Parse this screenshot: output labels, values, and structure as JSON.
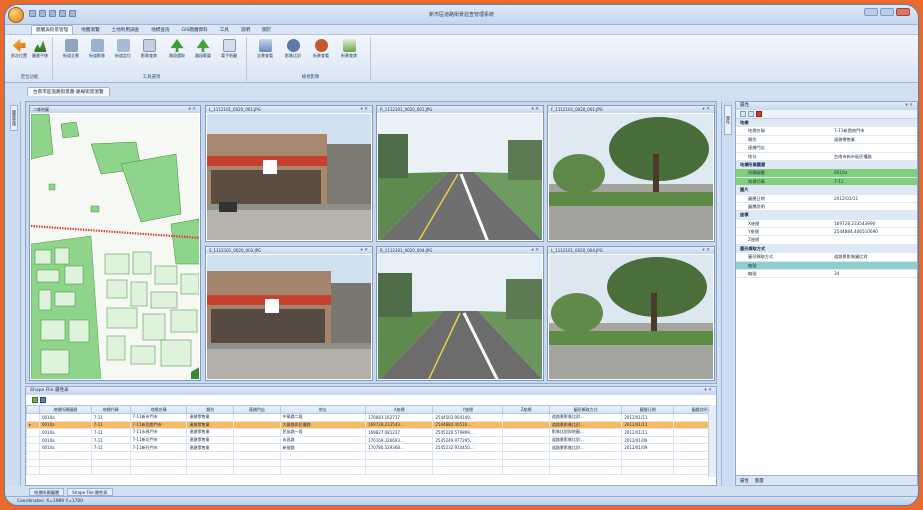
{
  "window": {
    "title": "新市區道路街景巡查管理系統"
  },
  "menu": {
    "tabs": [
      "圖層與街景管理",
      "地圖瀏覽",
      "土地利用調查",
      "地標查詢",
      "GIS圖層資料",
      "工具",
      "說明",
      "關於"
    ],
    "active_index": 0
  },
  "ribbon": {
    "groups": [
      {
        "label": "定位功能",
        "buttons": [
          "前次位置",
          "圖層平移"
        ]
      },
      {
        "label": "工具選項",
        "buttons": [
          "街道全景",
          "街道影像",
          "街道定位",
          "影像查詢",
          "路段選取",
          "路段範圍",
          "電子地圖"
        ]
      },
      {
        "label": "檢視影像",
        "buttons": [
          "全景查看",
          "影像比對",
          "街景查看",
          "街景查詢"
        ]
      }
    ]
  },
  "doc_tab": "台南市區道路街景圖-路線街景瀏覽",
  "left_strip_tab": "圖層管理",
  "right_strip_tab": "屬性",
  "map_pane": {
    "title": "二維地圖"
  },
  "photos": [
    {
      "title": "L_1112101_0020_001.JPG"
    },
    {
      "title": "R_1112101_0020_001.JPG"
    },
    {
      "title": "F_1112101_0020_001.JPG"
    },
    {
      "title": "S_1112101_0020_003.JPG"
    },
    {
      "title": "R_1112101_0020_004.JPG"
    },
    {
      "title": "L_1112101_0020_004.JPG"
    }
  ],
  "attributes": {
    "title": "屬性",
    "rows": [
      {
        "k": "地標",
        "v": "",
        "type": "cat"
      },
      {
        "k": "地標名稱",
        "v": "7-11新園南門市",
        "type": ""
      },
      {
        "k": "類別",
        "v": "連鎖零售業",
        "type": ""
      },
      {
        "k": "連鎖門店",
        "v": "",
        "type": ""
      },
      {
        "k": "地址",
        "v": "台南市新市區民權路",
        "type": ""
      },
      {
        "k": "地標所屬圖層",
        "v": "",
        "type": "cat"
      },
      {
        "k": "所屬圖層",
        "v": "0010a",
        "type": "green"
      },
      {
        "k": "地標代碼",
        "v": "7-11",
        "type": "green"
      },
      {
        "k": "圖片",
        "v": "",
        "type": "cat"
      },
      {
        "k": "圖層日期",
        "v": "2012/01/11",
        "type": ""
      },
      {
        "k": "圖層說明",
        "v": "",
        "type": ""
      },
      {
        "k": "座標",
        "v": "",
        "type": "cat"
      },
      {
        "k": "X座標",
        "v": "169728.233543990",
        "type": ""
      },
      {
        "k": "Y座標",
        "v": "2544884.406510690",
        "type": ""
      },
      {
        "k": "Z座標",
        "v": "",
        "type": ""
      },
      {
        "k": "圖形擷取方式",
        "v": "",
        "type": "cat"
      },
      {
        "k": "圖形擷取方式",
        "v": "道路景影像圖比對",
        "type": ""
      },
      {
        "k": "編號",
        "v": "",
        "type": "teal"
      },
      {
        "k": "編號",
        "v": "34",
        "type": ""
      }
    ],
    "footer": [
      "屬性",
      "圖層"
    ]
  },
  "grid": {
    "title": "Shape File 屬性表",
    "columns": [
      "地標所屬圖層",
      "地標代碼",
      "地標名稱",
      "類別",
      "連鎖門店",
      "地址",
      "X座標",
      "Y座標",
      "Z座標",
      "圖形擷取方式",
      "圖層日期",
      "圖層說明"
    ],
    "rows": [
      [
        "0010a",
        "7-11",
        "7-11新市門市",
        "連鎖零售業",
        "",
        "中華路二段",
        "170081.162717",
        "2544503.904149…",
        "",
        "道路景影像比對…",
        "2012/01/11",
        ""
      ],
      [
        "0010a",
        "7-11",
        "7-11新園南門市",
        "連鎖零售業",
        "",
        "大營路與民權路",
        "169728.233543…",
        "2544884.40510…",
        "",
        "道路景影像比對…",
        "2012/01/11",
        ""
      ],
      [
        "0010a",
        "7-11",
        "7-11永昇門市",
        "連鎖零售業",
        "",
        "民族路一段",
        "169827.081237",
        "2545220.579899…",
        "",
        "影像比對與地圖…",
        "2012/01/11",
        ""
      ],
      [
        "0010a",
        "7-11",
        "7-11新坊門市",
        "連鎖零售業",
        "",
        "永昌路",
        "170169.326693…",
        "2545249.977295…",
        "",
        "道路景影像比對…",
        "2012/01/09",
        ""
      ],
      [
        "0010a",
        "7-11",
        "7-11新旺門市",
        "連鎖零售業",
        "",
        "新營路",
        "170780.529368…",
        "2545232.910450…",
        "",
        "道路景影像比對…",
        "2012/01/09",
        ""
      ],
      [
        "",
        "",
        "",
        "",
        "",
        "",
        "",
        "",
        "",
        "",
        "",
        ""
      ],
      [
        "",
        "",
        "",
        "",
        "",
        "",
        "",
        "",
        "",
        "",
        "",
        ""
      ],
      [
        "",
        "",
        "",
        "",
        "",
        "",
        "",
        "",
        "",
        "",
        "",
        ""
      ]
    ],
    "selected_index": 1
  },
  "bottom_tabs": [
    "地標所屬圖層",
    "Shape File 屬性表"
  ],
  "status": "Coordinates: X=1989  Y=1700"
}
